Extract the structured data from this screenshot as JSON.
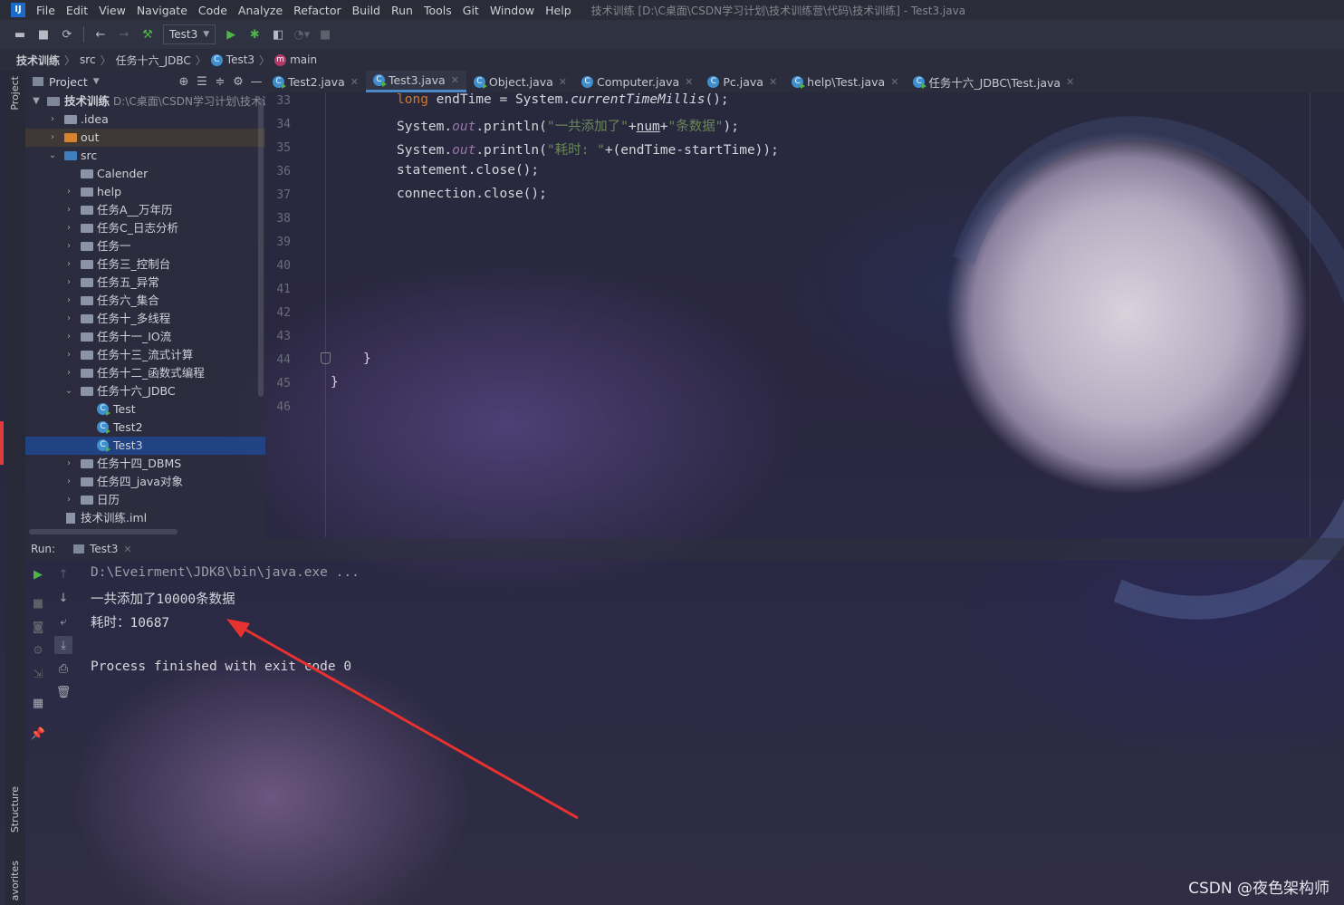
{
  "window": {
    "title": "技术训练 [D:\\C桌面\\CSDN学习计划\\技术训练营\\代码\\技术训练] - Test3.java",
    "logo": "IJ"
  },
  "menu": [
    "File",
    "Edit",
    "View",
    "Navigate",
    "Code",
    "Analyze",
    "Refactor",
    "Build",
    "Run",
    "Tools",
    "Git",
    "Window",
    "Help"
  ],
  "toolbar": {
    "run_config": "Test3",
    "icons": [
      "open-icon",
      "save-icon",
      "sync-icon",
      "back-icon",
      "forward-icon",
      "build-icon",
      "run-icon",
      "debug-icon",
      "coverage-icon",
      "profile-icon",
      "stop-icon"
    ]
  },
  "breadcrumb": [
    "技术训练",
    "src",
    "任务十六_JDBC",
    "Test3",
    "main"
  ],
  "left_stripe": {
    "project": "Project",
    "structure": "Structure",
    "favorites": "avorites"
  },
  "project_panel": {
    "title": "Project",
    "root": {
      "name": "技术训练",
      "path": "D:\\C桌面\\CSDN学习计划\\技术训"
    },
    "tree": [
      {
        "label": "技术训练",
        "depth": 0
      },
      {
        "label": ".idea",
        "depth": 1
      },
      {
        "label": "out",
        "depth": 1
      },
      {
        "label": "src",
        "depth": 1
      },
      {
        "label": "Calender",
        "depth": 2
      },
      {
        "label": "help",
        "depth": 2
      },
      {
        "label": "任务A__万年历",
        "depth": 2
      },
      {
        "label": "任务C_日志分析",
        "depth": 2
      },
      {
        "label": "任务一",
        "depth": 2
      },
      {
        "label": "任务三_控制台",
        "depth": 2
      },
      {
        "label": "任务五_异常",
        "depth": 2
      },
      {
        "label": "任务六_集合",
        "depth": 2
      },
      {
        "label": "任务十_多线程",
        "depth": 2
      },
      {
        "label": "任务十一_IO流",
        "depth": 2
      },
      {
        "label": "任务十三_流式计算",
        "depth": 2
      },
      {
        "label": "任务十二_函数式编程",
        "depth": 2
      },
      {
        "label": "任务十六_JDBC",
        "depth": 2
      },
      {
        "label": "Test",
        "depth": 3
      },
      {
        "label": "Test2",
        "depth": 3
      },
      {
        "label": "Test3",
        "depth": 3
      },
      {
        "label": "任务十四_DBMS",
        "depth": 2
      },
      {
        "label": "任务四_java对象",
        "depth": 2
      },
      {
        "label": "日历",
        "depth": 2
      },
      {
        "label": "技术训练.iml",
        "depth": 1
      }
    ]
  },
  "editor_tabs": [
    "Test2.java",
    "Test3.java",
    "Object.java",
    "Computer.java",
    "Pc.java",
    "help\\Test.java",
    "任务十六_JDBC\\Test.java"
  ],
  "active_tab": "Test3.java",
  "code": {
    "line_numbers": [
      "33",
      "34",
      "35",
      "36",
      "37",
      "38",
      "39",
      "40",
      "41",
      "42",
      "43",
      "44",
      "45",
      "46"
    ],
    "l33_kw": "long",
    "l33_a": " endTime = System.",
    "l33_m": "currentTimeMillis",
    "l33_b": "();",
    "l34_a": "System.",
    "l34_f": "out",
    "l34_b": ".println(",
    "l34_s1": "\"一共添加了\"",
    "l34_c": "+",
    "l34_v": "num",
    "l34_d": "+",
    "l34_s2": "\"条数据\"",
    "l34_e": ");",
    "l35_a": "System.",
    "l35_f": "out",
    "l35_b": ".println(",
    "l35_s": "\"耗时: \"",
    "l35_c": "+(endTime-startTime));",
    "l36": "statement.close();",
    "l37": "connection.close();",
    "l44": "}",
    "l45": "}"
  },
  "run_panel": {
    "label": "Run:",
    "tab": "Test3",
    "console": [
      "D:\\Eveirment\\JDK8\\bin\\java.exe ...",
      "一共添加了10000条数据",
      "耗时：10687",
      "",
      "Process finished with exit code 0"
    ]
  },
  "watermark": "CSDN @夜色架构师"
}
